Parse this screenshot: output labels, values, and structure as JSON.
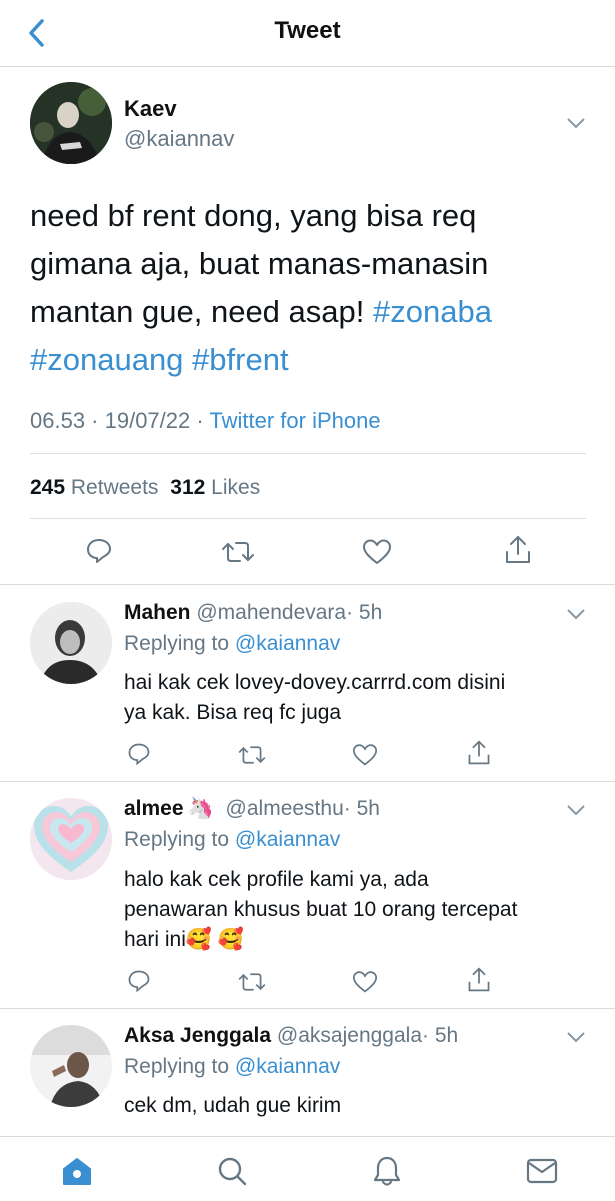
{
  "header": {
    "title": "Tweet"
  },
  "main_tweet": {
    "name": "Kaev",
    "handle": "@kaiannav",
    "text_line1": "need bf rent dong, yang bisa req",
    "text_line2": "gimana aja, buat manas-manasin",
    "text_line3_plain": "mantan gue, need asap! ",
    "hashtag1": "#zonaba",
    "hashtag2": "#zonauang",
    "hashtag3": "#bfrent",
    "time": "06.53 · 19/07/22 ·",
    "source": "Twitter for iPhone",
    "retweets_count": "245",
    "retweets_label": "Retweets",
    "likes_count": "312",
    "likes_label": "Likes"
  },
  "replies": [
    {
      "name": "Mahen",
      "handle": "@mahendevara",
      "time": "· 5h",
      "replying_label": "Replying to",
      "replying_handle": "@kaiannav",
      "lines": [
        "hai kak cek lovey-dovey.carrrd.com disini",
        "ya kak. Bisa req fc juga"
      ]
    },
    {
      "name": "almee",
      "name_emoji": "🦄",
      "handle": "@almeesthu",
      "time": "· 5h",
      "replying_label": "Replying to",
      "replying_handle": "@kaiannav",
      "lines": [
        "halo kak cek profile kami ya, ada",
        "penawaran khusus buat 10 orang tercepat",
        "hari ini🥰 🥰"
      ]
    },
    {
      "name": "Aksa Jenggala",
      "handle": "@aksajenggala",
      "time": "· 5h",
      "replying_label": "Replying to",
      "replying_handle": "@kaiannav",
      "lines": [
        "cek dm, udah gue kirim"
      ]
    }
  ],
  "colors": {
    "accent": "#3a8fd0",
    "muted": "#667784",
    "divider": "#dcdcdc"
  },
  "icons": [
    "back-chevron-icon",
    "reply-icon",
    "retweet-icon",
    "like-icon",
    "share-icon",
    "home-icon",
    "search-icon",
    "notifications-icon",
    "messages-icon",
    "chevron-down-icon"
  ]
}
